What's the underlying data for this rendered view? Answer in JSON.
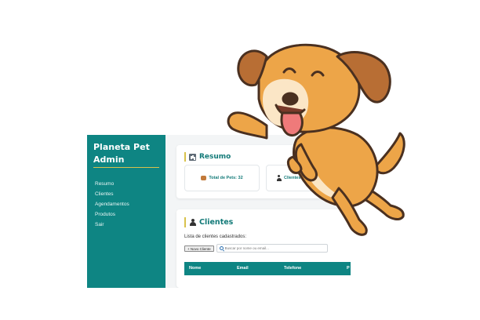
{
  "sidebar": {
    "brand": "Planeta Pet Admin",
    "items": [
      {
        "label": "Resumo"
      },
      {
        "label": "Clientes"
      },
      {
        "label": "Agendamentos"
      },
      {
        "label": "Produtos"
      },
      {
        "label": "Sair"
      }
    ]
  },
  "resumo": {
    "title": "Resumo",
    "title_icon": "bar-chart-icon",
    "stats": [
      {
        "label": "Total de Pets: 32",
        "icon": "pet-icon"
      },
      {
        "label": "Clientes: 18",
        "icon": "person-icon"
      }
    ]
  },
  "clientes": {
    "title": "Clientes",
    "title_icon": "person-icon",
    "subtitle": "Lista de clientes cadastrados:",
    "new_button": "+ Novo Cliente",
    "search_placeholder": "Buscar por nome ou email...",
    "columns": [
      "Nome",
      "Email",
      "Telefone",
      "P"
    ]
  },
  "colors": {
    "sidebar": "#0e8583",
    "accent": "#d8c24c",
    "title": "#127a78",
    "dog_fur": "#eda548",
    "dog_ears": "#b86e34"
  }
}
